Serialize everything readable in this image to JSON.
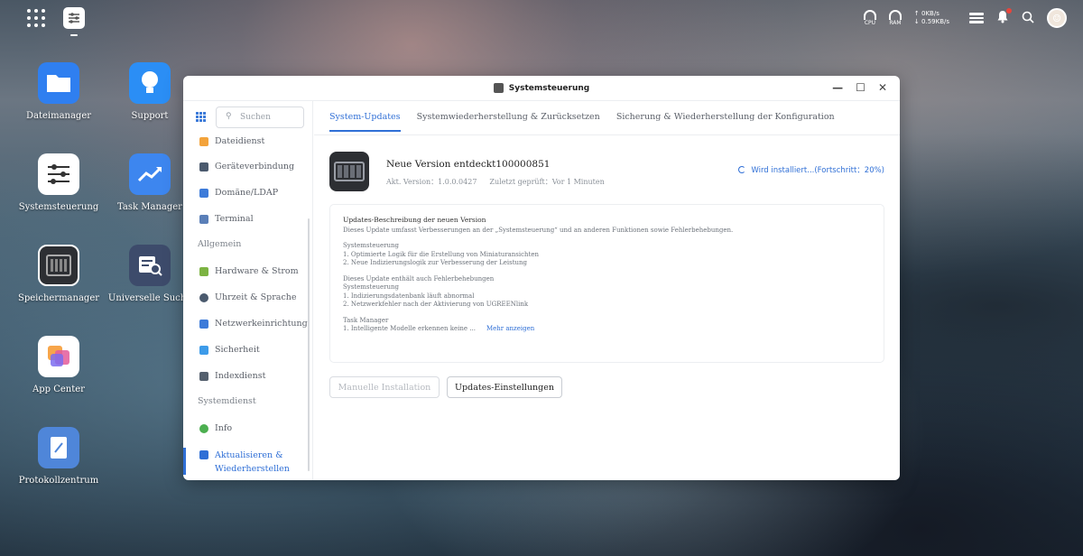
{
  "topbar": {
    "cpu_label": "CPU",
    "ram_label": "RAM",
    "net_up": "↑ 0KB/s",
    "net_down": "↓ 0.59KB/s"
  },
  "desktop": {
    "icons": [
      {
        "label": "Dateimanager",
        "icon": "folder-icon",
        "color": "#2f7ff0"
      },
      {
        "label": "Support",
        "icon": "lightbulb-icon",
        "color": "#2b8ef5"
      },
      {
        "label": "Systemsteuerung",
        "icon": "sliders-icon",
        "color": "#ffffff"
      },
      {
        "label": "Task Manager",
        "icon": "chart-trend-icon",
        "color": "#3d86ef"
      },
      {
        "label": "Speichermanager",
        "icon": "nas-icon",
        "color": "#2d2f33"
      },
      {
        "label": "Universelle Suche",
        "icon": "search-doc-icon",
        "color": "#3d4b6b"
      },
      {
        "label": "App Center",
        "icon": "app-center-icon",
        "color": "#ffffff"
      },
      {
        "label": "Protokollzentrum",
        "icon": "log-icon",
        "color": "#4f86d9"
      }
    ]
  },
  "window": {
    "title": "Systemsteuerung",
    "search_placeholder": "Suchen",
    "sidebar": {
      "items_top": [
        "Dateidienst",
        "Geräteverbindung",
        "Domäne/LDAP",
        "Terminal"
      ],
      "group_general": "Allgemein",
      "items_general": [
        "Hardware & Strom",
        "Uhrzeit & Sprache",
        "Netzwerkeinrichtung",
        "Sicherheit",
        "Indexdienst"
      ],
      "group_system": "Systemdienst",
      "items_system": [
        "Info",
        "Aktualisieren &",
        "Wiederherstellen"
      ]
    },
    "tabs": [
      "System-Updates",
      "Systemwiederherstellung & Zurücksetzen",
      "Sicherung & Wiederherstellung der Konfiguration"
    ],
    "update": {
      "title": "Neue Version entdeckt100000851",
      "current_version": "Akt. Version：1.0.0.0427",
      "last_checked": "Zuletzt geprüft：Vor 1 Minuten",
      "status": "Wird installiert...(Fortschritt：20%)",
      "progress": 0.2
    },
    "description": {
      "heading": "Updates-Beschreibung der neuen Version",
      "intro": "Dieses Update umfasst Verbesserungen an der „Systemsteuerung“ und an anderen Funktionen sowie Fehlerbehebungen.",
      "block1": [
        "Systemsteuerung",
        "1. Optimierte Logik für die Erstellung von Miniaturansichten",
        "2. Neue Indizierungslogik zur Verbesserung der Leistung"
      ],
      "block2": [
        "Dieses Update enthält auch Fehlerbehebungen",
        "Systemsteuerung",
        "1. Indizierungsdatenbank läuft abnormal",
        "2. Netzwerkfehler nach der Aktivierung von UGREENlink"
      ],
      "block3_title": "Task Manager",
      "block3_line": "1. Intelligente Modelle erkennen keine ...",
      "more": "Mehr anzeigen"
    },
    "buttons": {
      "manual": "Manuelle Installation",
      "settings": "Updates-Einstellungen"
    }
  }
}
